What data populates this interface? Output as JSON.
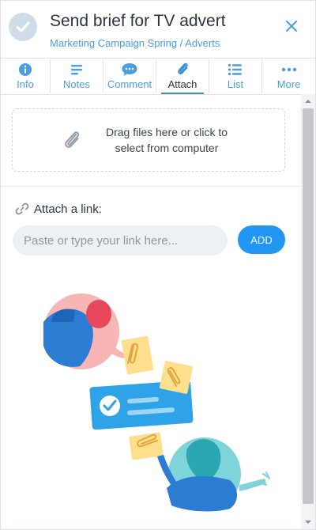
{
  "header": {
    "title": "Send brief for TV advert",
    "breadcrumb": "Marketing Campaign Spring / Adverts",
    "status_icon": "check-circle-icon",
    "close_icon": "close-icon"
  },
  "tabs": [
    {
      "label": "Info",
      "icon": "info-icon",
      "active": false
    },
    {
      "label": "Notes",
      "icon": "notes-icon",
      "active": false
    },
    {
      "label": "Comment",
      "icon": "comment-icon",
      "active": false
    },
    {
      "label": "Attach",
      "icon": "paperclip-icon",
      "active": true
    },
    {
      "label": "List",
      "icon": "list-icon",
      "active": false
    },
    {
      "label": "More",
      "icon": "more-icon",
      "active": false
    }
  ],
  "attach": {
    "dropzone_text": "Drag files here or click to select from computer",
    "link_label": "Attach a link:",
    "link_placeholder": "Paste or type your link here...",
    "add_label": "ADD"
  },
  "colors": {
    "accent": "#2196f3",
    "link_blue": "#4a9ee0",
    "text_dark": "#2b3440"
  }
}
